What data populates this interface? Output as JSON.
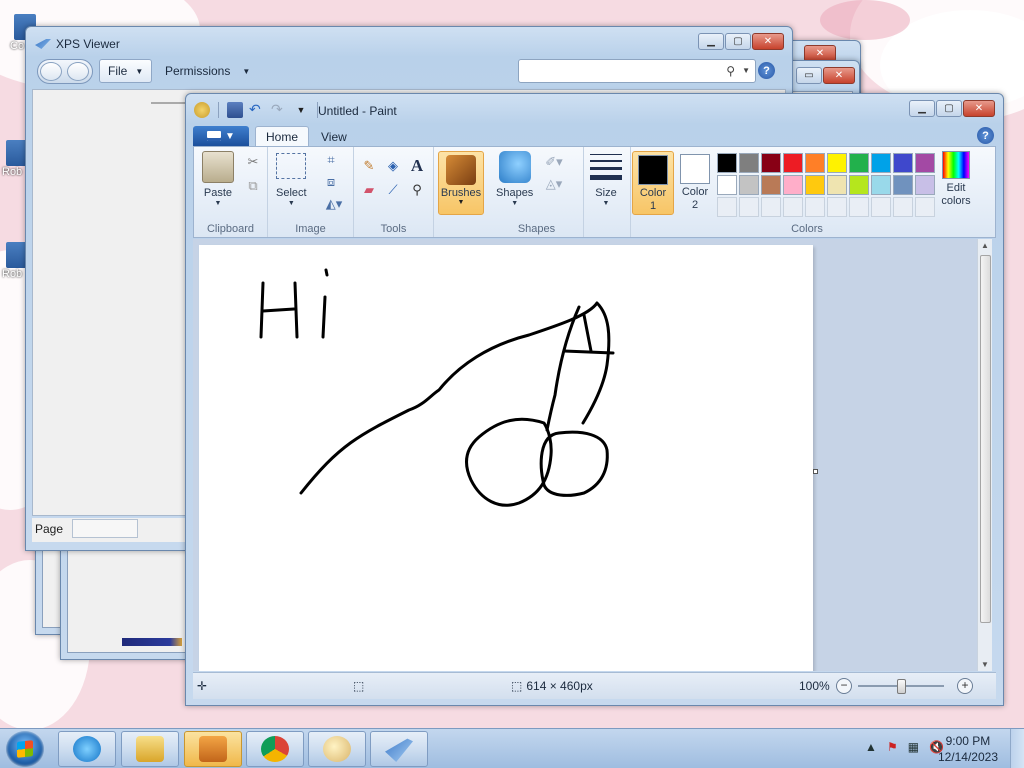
{
  "desktop": {
    "icons": [
      {
        "label": "Co"
      },
      {
        "label": "Rob"
      },
      {
        "label": "Rob"
      }
    ]
  },
  "xps_viewer": {
    "title": "XPS Viewer",
    "menu": {
      "file": "File",
      "permissions": "Permissions"
    },
    "search": {
      "value": ""
    },
    "status": {
      "page_label": "Page",
      "page_value": ""
    }
  },
  "paint": {
    "title": "Untitled - Paint",
    "tabs": [
      {
        "label": "Home"
      },
      {
        "label": "View"
      }
    ],
    "groups": {
      "clipboard": {
        "label": "Clipboard",
        "paste": "Paste"
      },
      "image": {
        "label": "Image",
        "select": "Select"
      },
      "tools": {
        "label": "Tools"
      },
      "brushes": {
        "label": "Brushes"
      },
      "shapes": {
        "label": "Shapes",
        "button": "Shapes"
      },
      "size": {
        "label": "Size"
      },
      "colors": {
        "label": "Colors",
        "color1": "Color 1",
        "color2": "Color 2",
        "edit": "Edit colors",
        "color1_value": "#000000",
        "color2_value": "#ffffff",
        "palette_row1": [
          "#000000",
          "#7f7f7f",
          "#880015",
          "#ed1c24",
          "#ff7f27",
          "#fff200",
          "#22b14c",
          "#00a2e8",
          "#3f48cc",
          "#a349a4"
        ],
        "palette_row2": [
          "#ffffff",
          "#c3c3c3",
          "#b97a57",
          "#ffaec9",
          "#ffc90e",
          "#efe4b0",
          "#b5e61d",
          "#99d9ea",
          "#7092be",
          "#c8bfe7"
        ]
      }
    },
    "drawing": {
      "text": "Hi"
    },
    "status": {
      "dimensions": "614 × 460px",
      "zoom": "100%"
    }
  },
  "taskbar": {
    "items": [
      "internet-explorer",
      "file-explorer",
      "media-player",
      "chrome",
      "paint",
      "xps-viewer"
    ],
    "clock_time": "9:00 PM",
    "clock_date": "12/14/2023"
  }
}
